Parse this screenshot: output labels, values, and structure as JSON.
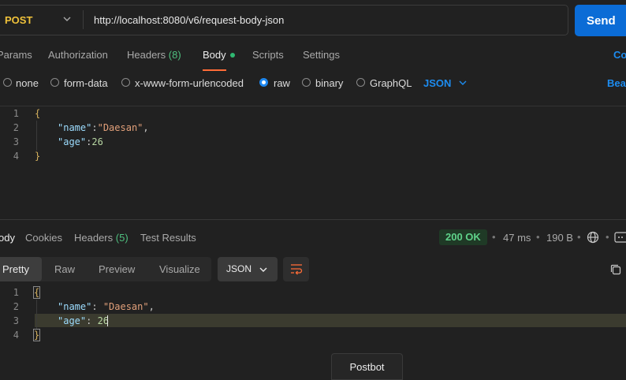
{
  "request": {
    "method": "POST",
    "url": "http://localhost:8080/v6/request-body-json",
    "send_label": "Send"
  },
  "request_tabs": {
    "params": "Params",
    "authorization": "Authorization",
    "headers": "Headers",
    "headers_count": "(8)",
    "body": "Body",
    "scripts": "Scripts",
    "settings": "Settings",
    "cookies_link": "Co"
  },
  "body_types": {
    "none": "none",
    "form_data": "form-data",
    "urlencoded": "x-www-form-urlencoded",
    "raw": "raw",
    "binary": "binary",
    "graphql": "GraphQL",
    "language": "JSON",
    "beautify_link": "Bea",
    "selected": "raw"
  },
  "request_editor": {
    "line_numbers": [
      "1",
      "2",
      "3",
      "4"
    ],
    "open_brace": "{",
    "close_brace": "}",
    "key1": "\"name\"",
    "colon1": ":",
    "val1": "\"Daesan\"",
    "comma1": ",",
    "key2": "\"age\"",
    "colon2": ":",
    "val2": "26"
  },
  "response_tabs": {
    "body": "ody",
    "cookies": "Cookies",
    "headers": "Headers",
    "headers_count": "(5)",
    "test_results": "Test Results"
  },
  "response_meta": {
    "status": "200 OK",
    "time": "47 ms",
    "size": "190 B"
  },
  "format_bar": {
    "pretty": "Pretty",
    "raw": "Raw",
    "preview": "Preview",
    "visualize": "Visualize",
    "language": "JSON"
  },
  "response_editor": {
    "line_numbers": [
      "1",
      "2",
      "3",
      "4"
    ],
    "open_brace": "{",
    "close_brace": "}",
    "key1": "\"name\"",
    "colon1": ": ",
    "val1": "\"Daesan\"",
    "comma1": ",",
    "key2": "\"age\"",
    "colon2": ": ",
    "val2": "26"
  },
  "postbot_label": "Postbot",
  "colors": {
    "accent": "#0b6cd6",
    "method": "#f0c23a",
    "status_ok": "#5fd38a",
    "active_tab_underline": "#ff6c37"
  }
}
